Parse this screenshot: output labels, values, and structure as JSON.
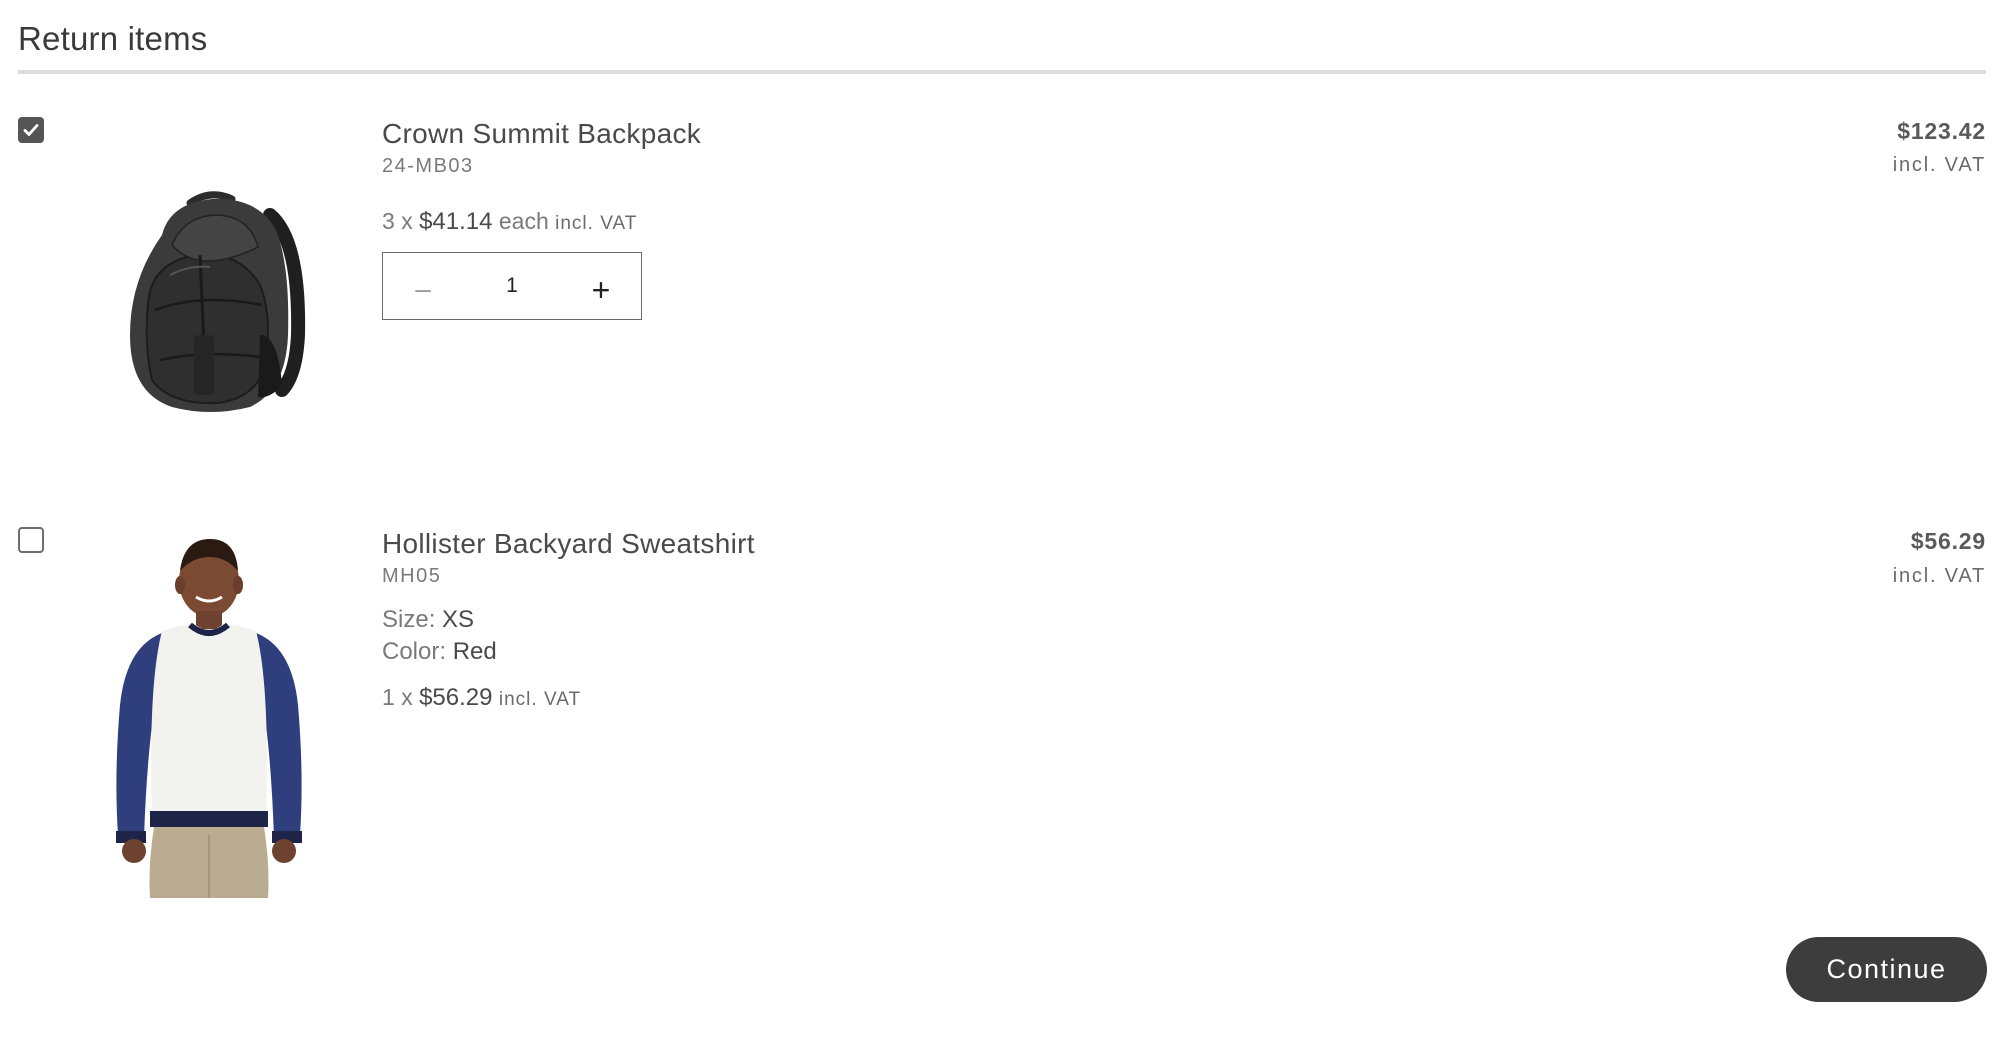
{
  "page": {
    "title": "Return items"
  },
  "items": [
    {
      "selected": true,
      "name": "Crown Summit Backpack",
      "sku": "24-MB03",
      "quantity_ordered": "3",
      "quantity_separator": "x",
      "unit_price": "$41.14",
      "each_label": "each",
      "vat_label": "incl. VAT",
      "return_quantity": "1",
      "minus_symbol": "–",
      "plus_symbol": "+",
      "total": "$123.42",
      "total_vat_label": "incl. VAT",
      "image_icon": "backpack-image"
    },
    {
      "selected": false,
      "name": "Hollister Backyard Sweatshirt",
      "sku": "MH05",
      "size_label": "Size:",
      "size_value": "XS",
      "color_label": "Color:",
      "color_value": "Red",
      "quantity_ordered": "1",
      "quantity_separator": "x",
      "unit_price": "$56.29",
      "vat_label": "incl. VAT",
      "total": "$56.29",
      "total_vat_label": "incl. VAT",
      "image_icon": "sweatshirt-image"
    }
  ],
  "actions": {
    "continue_label": "Continue"
  },
  "colors": {
    "primary_button": "#3d3d3d",
    "checkbox_checked": "#555555",
    "divider": "#dcdcdc",
    "sweatshirt_sleeves": "#2f3f7e",
    "sweatshirt_body": "#f2f2ee"
  }
}
